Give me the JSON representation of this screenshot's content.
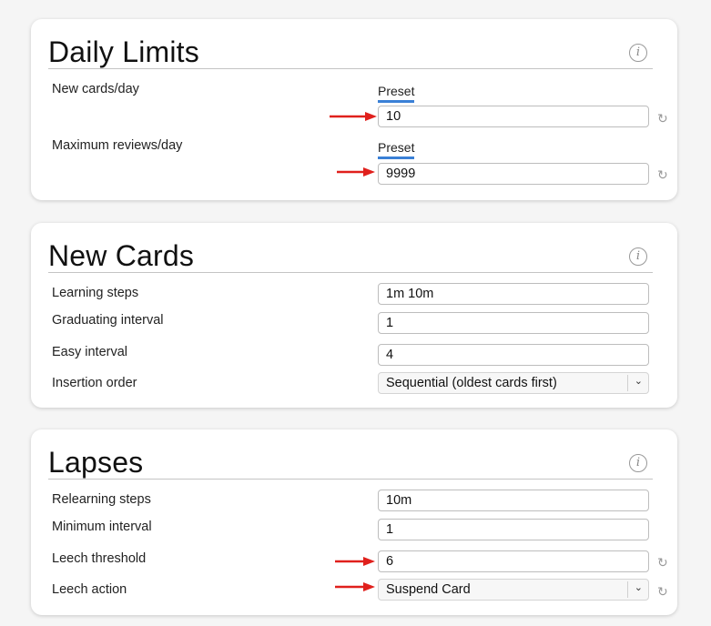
{
  "colors": {
    "accent": "#3a80d6",
    "arrow": "#e0201c"
  },
  "daily_limits": {
    "title": "Daily Limits",
    "info_icon": "info-icon",
    "new_cards": {
      "label": "New cards/day",
      "preset": "Preset",
      "value": "10"
    },
    "max_reviews": {
      "label": "Maximum reviews/day",
      "preset": "Preset",
      "value": "9999"
    }
  },
  "new_cards": {
    "title": "New Cards",
    "info_icon": "info-icon",
    "learning_steps": {
      "label": "Learning steps",
      "value": "1m 10m"
    },
    "graduating_interval": {
      "label": "Graduating interval",
      "value": "1"
    },
    "easy_interval": {
      "label": "Easy interval",
      "value": "4"
    },
    "insertion_order": {
      "label": "Insertion order",
      "value": "Sequential (oldest cards first)"
    }
  },
  "lapses": {
    "title": "Lapses",
    "info_icon": "info-icon",
    "relearning_steps": {
      "label": "Relearning steps",
      "value": "10m"
    },
    "minimum_interval": {
      "label": "Minimum interval",
      "value": "1"
    },
    "leech_threshold": {
      "label": "Leech threshold",
      "value": "6"
    },
    "leech_action": {
      "label": "Leech action",
      "value": "Suspend Card"
    }
  }
}
